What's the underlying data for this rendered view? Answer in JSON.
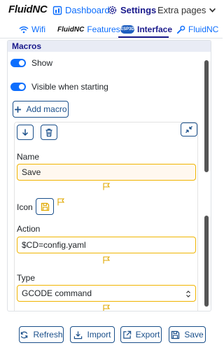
{
  "navbar": {
    "brand": "FluidNC",
    "dashboard": "Dashboard",
    "settings": "Settings",
    "extra_pages": "Extra pages"
  },
  "tabs": {
    "wifi": "Wifi",
    "features_brand": "FluidNC",
    "features": "Features",
    "interface_logo": "ESP3D",
    "interface": "Interface",
    "fluidnc": "FluidNC"
  },
  "panel": {
    "header": "Macros",
    "show_label": "Show",
    "visible_label": "Visible when starting",
    "add_macro": "Add macro"
  },
  "macro": {
    "name_label": "Name",
    "name_value": "Save",
    "icon_label": "Icon",
    "action_label": "Action",
    "action_value": "$CD=config.yaml",
    "type_label": "Type",
    "type_value": "GCODE command"
  },
  "footer": {
    "refresh": "Refresh",
    "import": "Import",
    "export": "Export",
    "save": "Save"
  },
  "colors": {
    "accent": "#0d6efd",
    "active": "#1a1a8c",
    "outline": "#1a4f8a",
    "warning": "#f0b400"
  }
}
